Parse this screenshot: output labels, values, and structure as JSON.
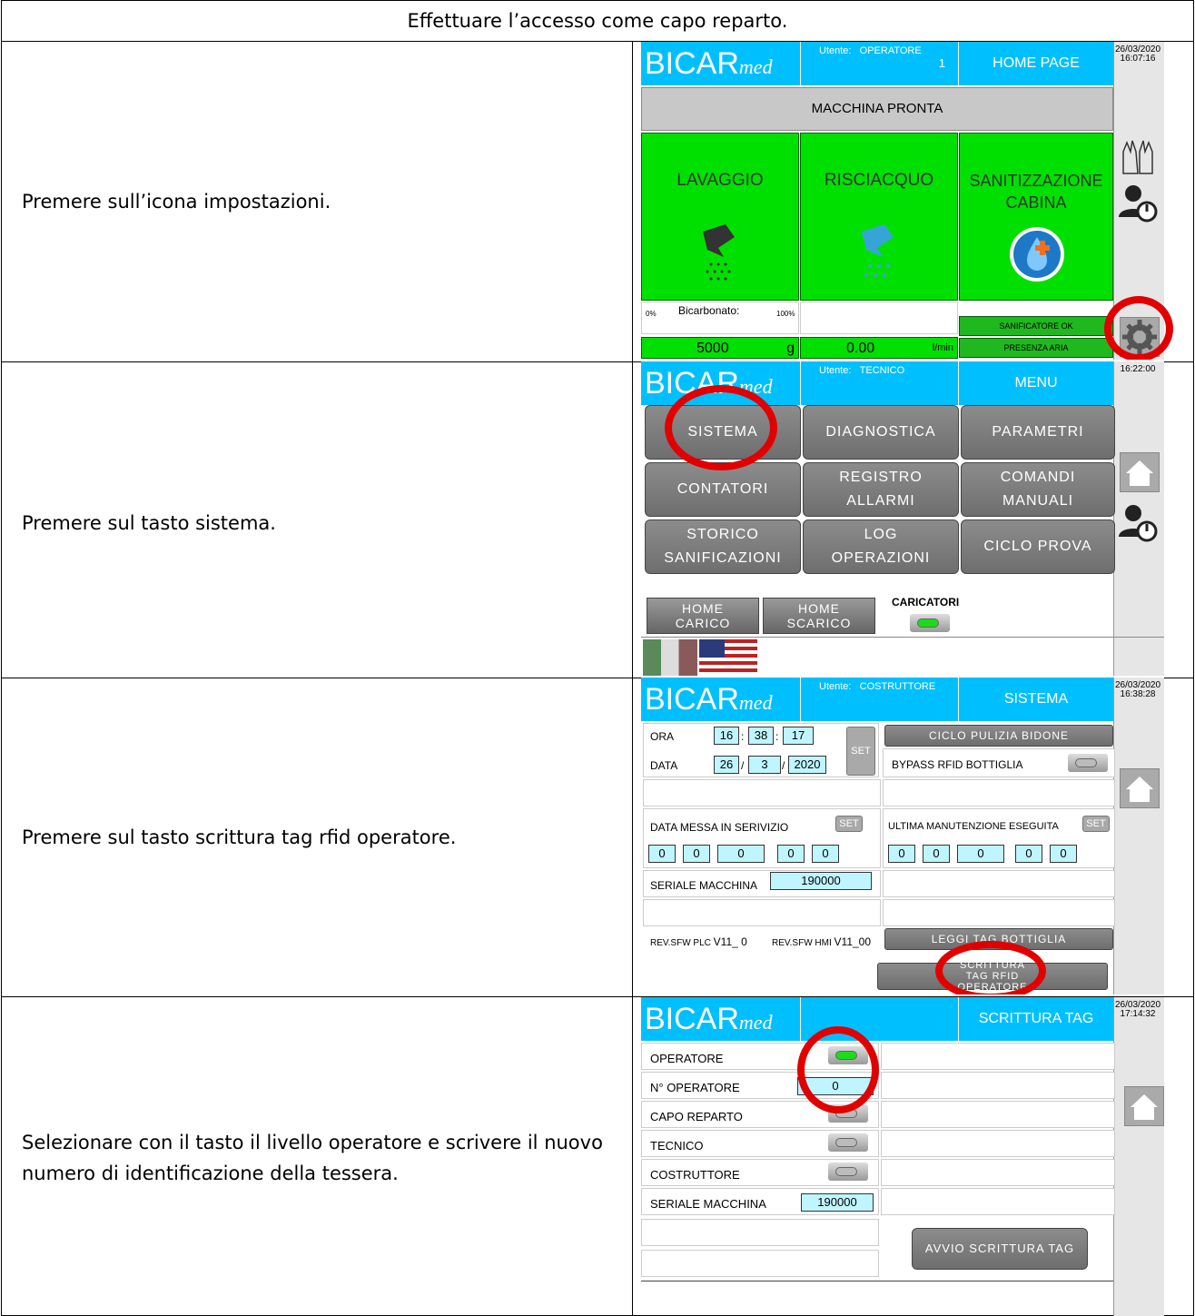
{
  "header": {
    "title": "Effettuare l’accesso come capo reparto."
  },
  "steps": [
    "Premere sull’icona impostazioni.",
    "Premere sul tasto sistema.",
    "Premere sul tasto scrittura tag rfid operatore.",
    "Selezionare con il tasto il livello operatore e scrivere il nuovo numero di identificazione della tessera."
  ],
  "common": {
    "logo_main": "BICAR",
    "logo_sub": "med",
    "user_prefix": "Utente:"
  },
  "s1": {
    "user": "OPERATORE",
    "user_num": "1",
    "page": "HOME PAGE",
    "date": "26/03/2020",
    "time": "16:07:16",
    "status": "MACCHINA PRONTA",
    "tile1": "LAVAGGIO",
    "tile2": "RISCIACQUO",
    "tile3": "SANITIZZAZIONE CABINA",
    "bicarb_label": "Bicarbonato:",
    "bicarb_min": "0%",
    "bicarb_max": "100%",
    "bicarb_value": "5000",
    "bicarb_unit": "g",
    "flow_value": "0.00",
    "flow_unit": "l/min",
    "sanif_ok": "SANIFICATORE OK",
    "presenza": "PRESENZA ARIA"
  },
  "s2": {
    "user": "TECNICO",
    "page": "MENU",
    "date": "",
    "time": "16:22:00",
    "buttons": [
      "SISTEMA",
      "DIAGNOSTICA",
      "PARAMETRI",
      "CONTATORI",
      "REGISTRO ALLARMI",
      "COMANDI MANUALI",
      "STORICO SANIFICAZIONI",
      "LOG OPERAZIONI",
      "CICLO PROVA"
    ],
    "home_carico": "HOME CARICO",
    "home_scarico": "HOME SCARICO",
    "caricatori": "CARICATORI"
  },
  "s3": {
    "user": "COSTRUTTORE",
    "page": "SISTEMA",
    "date": "26/03/2020",
    "time": "16:38:28",
    "ora_label": "ORA",
    "ora_h": "16",
    "ora_m": "38",
    "ora_s": "17",
    "data_label": "DATA",
    "data_d": "26",
    "data_mo": "3",
    "data_y": "2020",
    "set": "SET",
    "ciclo": "CICLO PULIZIA BIDONE",
    "bypass": "BYPASS RFID BOTTIGLIA",
    "messa": "DATA MESSA IN SERIVIZIO",
    "manut": "ULTIMA MANUTENZIONE ESEGUITA",
    "zero": "0",
    "seriale_label": "SERIALE MACCHINA",
    "seriale": "190000",
    "rev_plc_label": "REV.SFW PLC",
    "rev_plc": "V11_ 0",
    "rev_hmi_label": "REV.SFW HMI",
    "rev_hmi": "V11_00",
    "leggi": "LEGGI TAG BOTTIGLIA",
    "scrittura": "SCRITTURA TAG RFID OPERATORE"
  },
  "s4": {
    "page": "SCRITTURA TAG",
    "date": "26/03/2020",
    "time": "17:14:32",
    "operatore": "OPERATORE",
    "n_oper": "N° OPERATORE",
    "n_value": "0",
    "capo": "CAPO REPARTO",
    "tecnico": "TECNICO",
    "costruttore": "COSTRUTTORE",
    "seriale_label": "SERIALE MACCHINA",
    "seriale": "190000",
    "avvio": "AVVIO SCRITTURA TAG"
  }
}
